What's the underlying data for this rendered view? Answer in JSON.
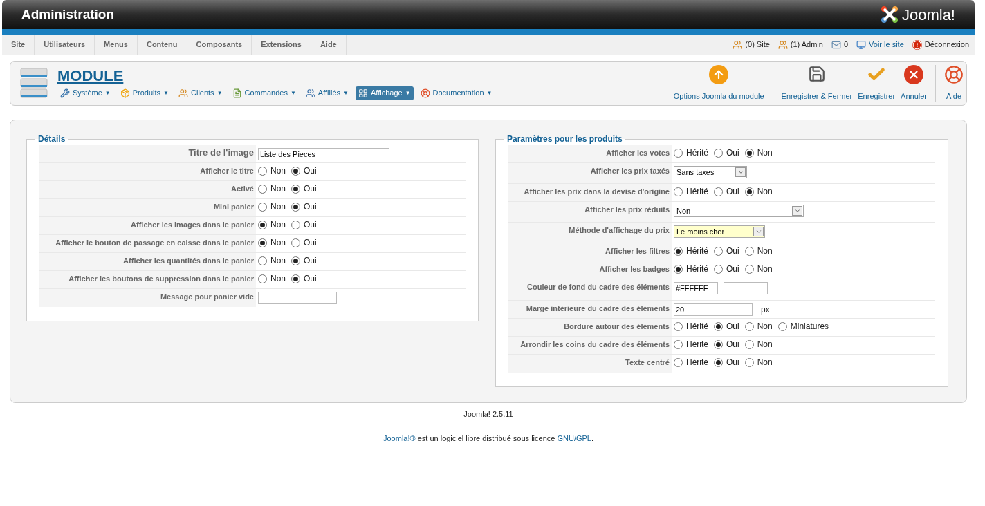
{
  "header": {
    "title": "Administration",
    "logo_text": "Joomla!"
  },
  "menu": [
    {
      "label": "Site"
    },
    {
      "label": "Utilisateurs"
    },
    {
      "label": "Menus"
    },
    {
      "label": "Contenu"
    },
    {
      "label": "Composants"
    },
    {
      "label": "Extensions"
    },
    {
      "label": "Aide"
    }
  ],
  "status": [
    {
      "kind": "users",
      "label": "(0) Site",
      "link": false
    },
    {
      "kind": "users",
      "label": "(1) Admin",
      "link": false
    },
    {
      "kind": "mail",
      "label": "0",
      "link": false
    },
    {
      "kind": "screen",
      "label": "Voir le site",
      "link": true
    },
    {
      "kind": "logout",
      "label": "Déconnexion",
      "link": false
    }
  ],
  "toolbar": {
    "title": "MODULE",
    "caret": "▼",
    "submenu": [
      {
        "kind": "tools",
        "label": "Système",
        "selected": false
      },
      {
        "kind": "box",
        "label": "Produits",
        "selected": false
      },
      {
        "kind": "users",
        "label": "Clients",
        "selected": false
      },
      {
        "kind": "doc",
        "label": "Commandes",
        "selected": false
      },
      {
        "kind": "affiliate",
        "label": "Affiliés",
        "selected": false
      },
      {
        "kind": "layout",
        "label": "Affichage",
        "selected": true
      },
      {
        "kind": "help",
        "label": "Documentation",
        "selected": false
      }
    ],
    "buttons": [
      {
        "kind": "options",
        "label": "Options Joomla du module"
      },
      {
        "kind": "save",
        "label": "Enregistrer & Fermer"
      },
      {
        "kind": "check",
        "label": "Enregistrer"
      },
      {
        "kind": "cancel",
        "label": "Annuler"
      },
      {
        "kind": "help",
        "label": "Aide"
      }
    ]
  },
  "left_panel": {
    "legend": "Détails",
    "rows": [
      {
        "label": "Titre de l'image",
        "kind": "text",
        "value": "Liste des Pieces"
      },
      {
        "label": "Afficher le titre",
        "kind": "radio",
        "options": [
          {
            "label": "Non",
            "selected": false
          },
          {
            "label": "Oui",
            "selected": true
          }
        ]
      },
      {
        "label": "Activé",
        "kind": "radio",
        "options": [
          {
            "label": "Non",
            "selected": false
          },
          {
            "label": "Oui",
            "selected": true
          }
        ]
      },
      {
        "label": "Mini panier",
        "kind": "radio",
        "options": [
          {
            "label": "Non",
            "selected": false
          },
          {
            "label": "Oui",
            "selected": true
          }
        ]
      },
      {
        "label": "Afficher les images dans le panier",
        "kind": "radio",
        "options": [
          {
            "label": "Non",
            "selected": true
          },
          {
            "label": "Oui",
            "selected": false
          }
        ]
      },
      {
        "label": "Afficher le bouton de passage en caisse dans le panier",
        "kind": "radio",
        "options": [
          {
            "label": "Non",
            "selected": true
          },
          {
            "label": "Oui",
            "selected": false
          }
        ]
      },
      {
        "label": "Afficher les quantités dans le panier",
        "kind": "radio",
        "options": [
          {
            "label": "Non",
            "selected": false
          },
          {
            "label": "Oui",
            "selected": true
          }
        ]
      },
      {
        "label": "Afficher les boutons de suppression dans le panier",
        "kind": "radio",
        "options": [
          {
            "label": "Non",
            "selected": false
          },
          {
            "label": "Oui",
            "selected": true
          }
        ]
      },
      {
        "label": "Message pour panier vide",
        "kind": "text"
      }
    ]
  },
  "right_panel": {
    "legend": "Paramètres pour les produits",
    "rows": [
      {
        "label": "Afficher les votes",
        "kind": "radio",
        "options": [
          {
            "label": "Hérité",
            "selected": false
          },
          {
            "label": "Oui",
            "selected": false
          },
          {
            "label": "Non",
            "selected": true
          }
        ]
      },
      {
        "label": "Afficher les prix taxés",
        "kind": "select",
        "value": "Sans taxes",
        "highlighted": false
      },
      {
        "label": "Afficher les prix dans la devise d'origine",
        "kind": "radio",
        "options": [
          {
            "label": "Hérité",
            "selected": false
          },
          {
            "label": "Oui",
            "selected": false
          },
          {
            "label": "Non",
            "selected": true
          }
        ]
      },
      {
        "label": "Afficher les prix réduits",
        "kind": "select",
        "value": "Non",
        "highlighted": false
      },
      {
        "label": "Méthode d'affichage du prix",
        "kind": "select",
        "value": "Le moins cher",
        "highlighted": true
      },
      {
        "label": "Afficher les filtres",
        "kind": "radio",
        "options": [
          {
            "label": "Hérité",
            "selected": true
          },
          {
            "label": "Oui",
            "selected": false
          },
          {
            "label": "Non",
            "selected": false
          }
        ]
      },
      {
        "label": "Afficher les badges",
        "kind": "radio",
        "options": [
          {
            "label": "Hérité",
            "selected": true
          },
          {
            "label": "Oui",
            "selected": false
          },
          {
            "label": "Non",
            "selected": false
          }
        ]
      },
      {
        "label": "Couleur de fond du cadre des éléments",
        "kind": "color",
        "value": "#FFFFFF"
      },
      {
        "label": "Marge intérieure du cadre des éléments",
        "kind": "text",
        "value": "20",
        "unit": "px"
      },
      {
        "label": "Bordure autour des éléments",
        "kind": "radio",
        "options": [
          {
            "label": "Hérité",
            "selected": false
          },
          {
            "label": "Oui",
            "selected": true
          },
          {
            "label": "Non",
            "selected": false
          },
          {
            "label": "Miniatures",
            "selected": false
          }
        ]
      },
      {
        "label": "Arrondir les coins du cadre des éléments",
        "kind": "radio",
        "options": [
          {
            "label": "Hérité",
            "selected": false
          },
          {
            "label": "Oui",
            "selected": true
          },
          {
            "label": "Non",
            "selected": false
          }
        ]
      },
      {
        "label": "Texte centré",
        "kind": "radio",
        "options": [
          {
            "label": "Hérité",
            "selected": false
          },
          {
            "label": "Oui",
            "selected": true
          },
          {
            "label": "Non",
            "selected": false
          }
        ]
      }
    ]
  },
  "footer": {
    "version": "Joomla! 2.5.11",
    "license": {
      "link_1": "Joomla!®",
      "text": " est un logiciel libre distribué sous licence ",
      "link_2": "GNU/GPL",
      "end": "."
    }
  }
}
